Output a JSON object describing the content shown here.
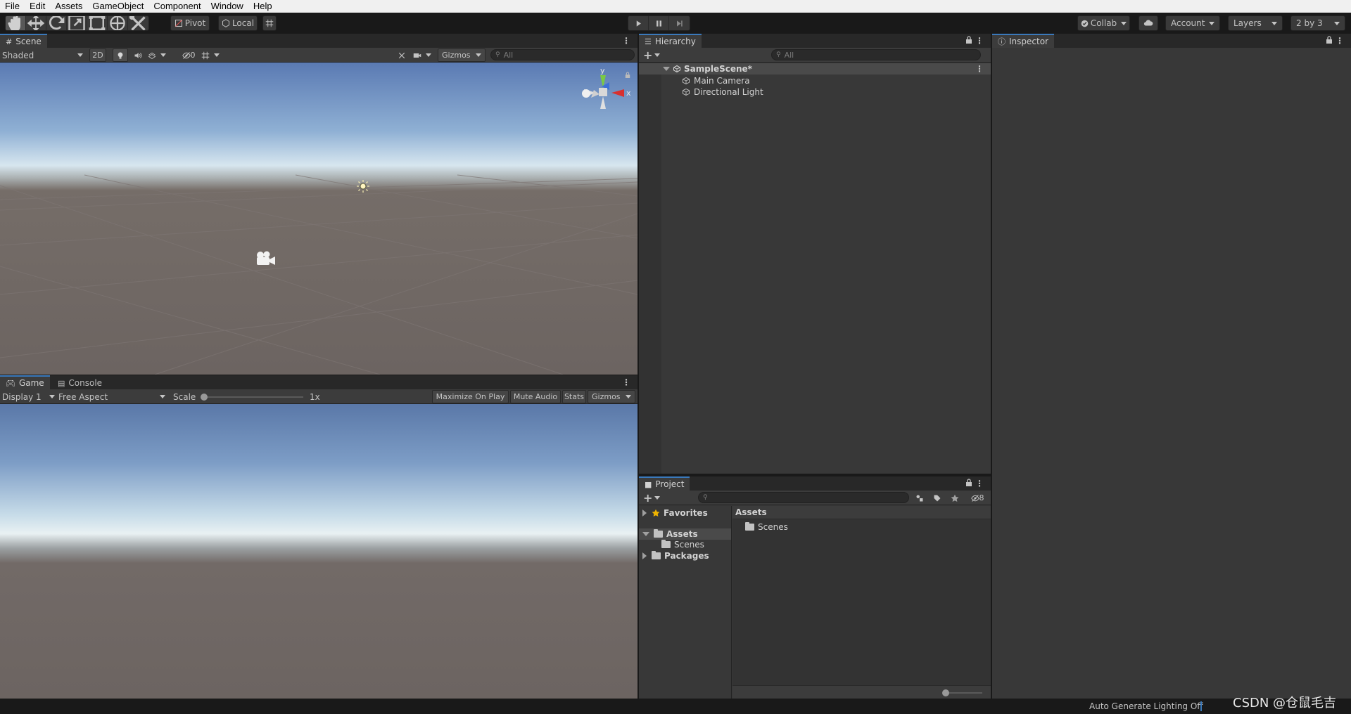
{
  "menu": [
    "File",
    "Edit",
    "Assets",
    "GameObject",
    "Component",
    "Window",
    "Help"
  ],
  "toolbar": {
    "pivot_label": "Pivot",
    "local_label": "Local",
    "collab_label": "Collab",
    "account_label": "Account",
    "layers_label": "Layers",
    "layout_label": "2 by 3"
  },
  "scene": {
    "tab_label": "Scene",
    "shading_mode": "Shaded",
    "mode_2d": "2D",
    "hidden_count": "0",
    "gizmos_label": "Gizmos",
    "search_placeholder": "All",
    "gizmo_y": "y",
    "gizmo_x": "x"
  },
  "game": {
    "tab_label": "Game",
    "console_tab_label": "Console",
    "display": "Display 1",
    "aspect": "Free Aspect",
    "scale_label": "Scale",
    "scale_value": "1x",
    "scale_level": 0.0,
    "maximize_label": "Maximize On Play",
    "mute_label": "Mute Audio",
    "stats_label": "Stats",
    "gizmos_label": "Gizmos"
  },
  "hierarchy": {
    "tab_label": "Hierarchy",
    "search_placeholder": "All",
    "scene_name": "SampleScene*",
    "items": [
      "Main Camera",
      "Directional Light"
    ]
  },
  "inspector": {
    "tab_label": "Inspector"
  },
  "project": {
    "tab_label": "Project",
    "hidden_count": "8",
    "tree": {
      "favorites": "Favorites",
      "assets": "Assets",
      "assets_child": "Scenes",
      "packages": "Packages"
    },
    "breadcrumb": "Assets",
    "folder_items": [
      "Scenes"
    ]
  },
  "status": {
    "lighting_text": "Auto Generate Lighting Off",
    "watermark": "CSDN @仓鼠毛吉"
  },
  "colors": {
    "accent": "#3a79bb",
    "panel": "#383838",
    "toolbar": "#191919",
    "sky_top": "#5b7bb4",
    "ground": "#6a6360"
  }
}
